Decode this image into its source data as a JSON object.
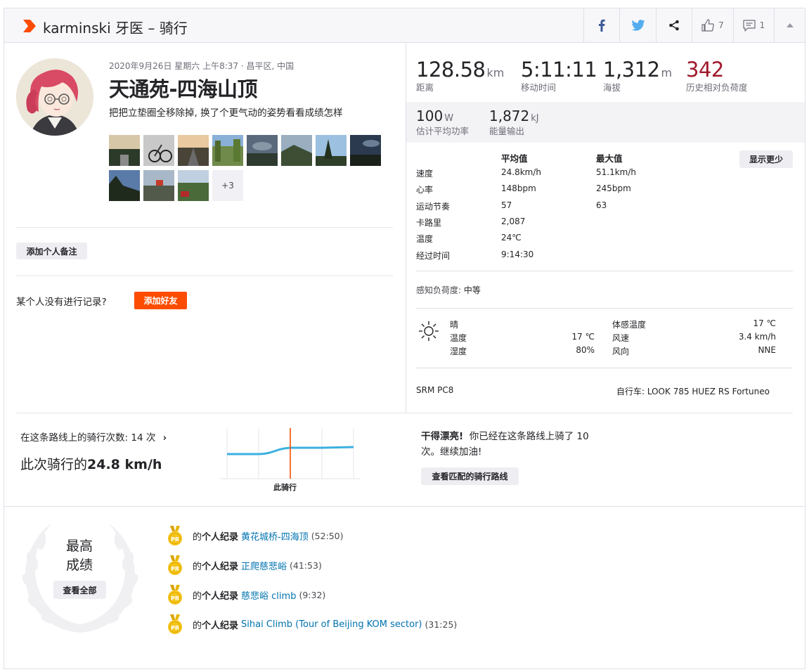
{
  "header": {
    "title": "karminski 牙医 – 骑行",
    "kudos_count": "7",
    "comment_count": "1"
  },
  "activity": {
    "meta": "2020年9月26日 星期六 上午8:37 · 昌平区, 中国",
    "title": "天通苑-四海山顶",
    "description": "把把立垫圈全移除掉, 换了个更气动的姿势看看成绩怎样",
    "more_photos": "+3",
    "add_note": "添加个人备注",
    "no_record_question": "某个人没有进行记录?",
    "add_friend": "添加好友"
  },
  "stats_main": [
    {
      "value": "128.58",
      "unit": "km",
      "label": "距离"
    },
    {
      "value": "5:11:11",
      "unit": "",
      "label": "移动时间"
    },
    {
      "value": "1,312",
      "unit": "m",
      "label": "海拔"
    },
    {
      "value": "342",
      "unit": "",
      "label": "历史相对负荷度"
    }
  ],
  "stats_secondary": [
    {
      "value": "100",
      "unit": "W",
      "label": "估计平均功率"
    },
    {
      "value": "1,872",
      "unit": "kJ",
      "label": "能量输出"
    }
  ],
  "detail_table": {
    "col_avg": "平均值",
    "col_max": "最大值",
    "show_more": "显示更少",
    "rows": [
      {
        "label": "速度",
        "avg": "24.8km/h",
        "max": "51.1km/h"
      },
      {
        "label": "心率",
        "avg": "148bpm",
        "max": "245bpm"
      },
      {
        "label": "运动节奏",
        "avg": "57",
        "max": "63"
      },
      {
        "label": "卡路里",
        "avg": "2,087",
        "max": ""
      },
      {
        "label": "温度",
        "avg": "24℃",
        "max": ""
      },
      {
        "label": "经过时间",
        "avg": "9:14:30",
        "max": ""
      }
    ]
  },
  "perceived_exertion": {
    "label": "感知负荷度:",
    "value": "中等"
  },
  "weather": {
    "condition": "晴",
    "left": [
      {
        "label": "温度",
        "value": "17 ℃"
      },
      {
        "label": "湿度",
        "value": "80%"
      }
    ],
    "right": [
      {
        "label": "体感温度",
        "value": "17 ℃"
      },
      {
        "label": "风速",
        "value": "3.4 km/h"
      },
      {
        "label": "风向",
        "value": "NNE"
      }
    ]
  },
  "gear": {
    "power_meter": "SRM PC8",
    "bike": "自行车: LOOK 785 HUEZ RS Fortuneo"
  },
  "route": {
    "rides_label": "在这条路线上的骑行次数:",
    "rides_count": "14 次",
    "speed_prefix": "此次骑行的",
    "speed_value": "24.8 km/h",
    "chart_label": "此骑行",
    "great_bold": "干得漂亮!",
    "great_text": "你已经在这条路线上骑了 10 次。继续加油!",
    "view_matched": "查看匹配的骑行路线"
  },
  "achievements": {
    "title_line1": "最高",
    "title_line2": "成绩",
    "view_all": "查看全部",
    "prefix": "的",
    "pr_label": "个人纪录",
    "medal_text": "PR",
    "items": [
      {
        "segment": "黄花城桥-四海顶",
        "time": "(52:50)"
      },
      {
        "segment": "正爬慈悲峪",
        "time": "(41:53)"
      },
      {
        "segment": "慈悲峪 climb",
        "time": "(9:32)"
      },
      {
        "segment": "Sihai Climb (Tour of Beijing KOM sector)",
        "time": "(31:25)"
      }
    ]
  },
  "colors": {
    "brand": "#fc4c02",
    "suffer": "#a0192b",
    "link": "#0073b0",
    "chart_line": "#3bb0e0"
  }
}
